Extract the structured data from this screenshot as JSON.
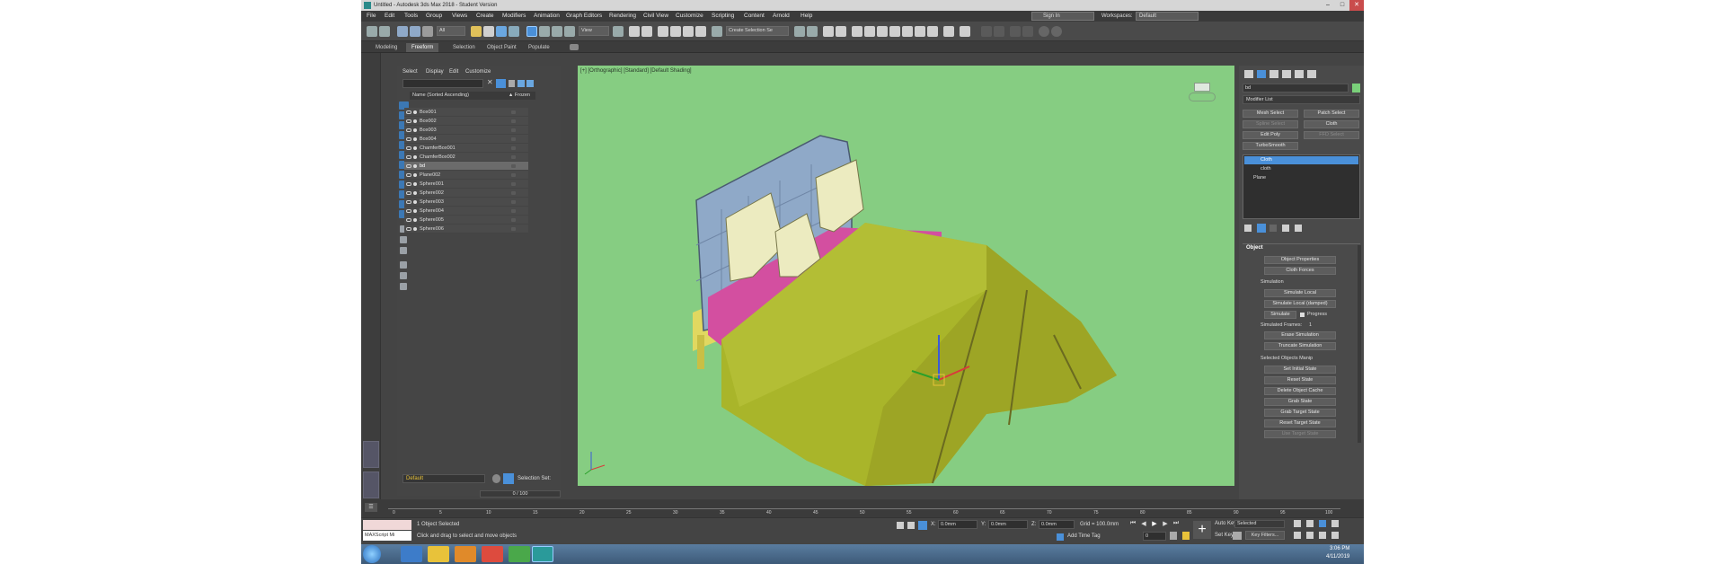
{
  "title_bar": {
    "title": "Untitled - Autodesk 3ds Max 2018 - Student Version"
  },
  "menu": [
    "File",
    "Edit",
    "Tools",
    "Group",
    "Views",
    "Create",
    "Modifiers",
    "Animation",
    "Graph Editors",
    "Rendering",
    "Civil View",
    "Customize",
    "Scripting",
    "Content",
    "Arnold",
    "Help"
  ],
  "user": {
    "sign_in": "Sign In",
    "workspaces_label": "Workspaces:",
    "workspace_value": "Default"
  },
  "toolbar": {
    "filter_value": "All",
    "view_value": "View",
    "selection_set_placeholder": "Create Selection Se"
  },
  "ribbon_tabs": [
    "Modeling",
    "Freeform",
    "Selection",
    "Object Paint",
    "Populate"
  ],
  "scene_explorer": {
    "menu": [
      "Select",
      "Display",
      "Edit",
      "Customize"
    ],
    "header_name": "Name (Sorted Ascending)",
    "header_frozen": "▲ Frozen",
    "rows": [
      "Box001",
      "Box002",
      "Box003",
      "Box004",
      "ChamferBox001",
      "ChamferBox002",
      "bd",
      "Plane002",
      "Sphere001",
      "Sphere002",
      "Sphere003",
      "Sphere004",
      "Sphere005",
      "Sphere006"
    ],
    "layer_value": "Default",
    "selection_set_label": "Selection Set:"
  },
  "viewport": {
    "label": "[+] [Orthographic] [Standard] [Default Shading]"
  },
  "command_panel": {
    "name_value": "bd",
    "modifier_list": "Modifier List",
    "buttons": [
      "Mesh Select",
      "Patch Select",
      "Spline Select",
      "Cloth",
      "Edit Poly",
      "FFD Select",
      "TurboSmooth"
    ],
    "stack": [
      "Cloth",
      "cloth",
      "Plane"
    ],
    "rollout_title": "Object",
    "object_buttons": [
      "Object Properties",
      "Cloth Forces"
    ],
    "simulation_label": "Simulation",
    "sim_buttons": [
      "Simulate Local",
      "Simulate Local (damped)",
      "Simulate"
    ],
    "progress_label": "Progress",
    "simulated_frames_label": "Simulated Frames:",
    "simulated_frames_value": "1",
    "sim_buttons2": [
      "Erase Simulation",
      "Truncate Simulation"
    ],
    "selected_manip_label": "Selected Objects Manip",
    "manip_buttons": [
      "Set Initial State",
      "Reset State",
      "Delete Object Cache",
      "Grab State",
      "Grab Target State",
      "Reset Target State",
      "Use Target State"
    ]
  },
  "timeline": {
    "frame_readout": "0 / 100",
    "ticks": [
      "0",
      "5",
      "10",
      "15",
      "20",
      "25",
      "30",
      "35",
      "40",
      "45",
      "50",
      "55",
      "60",
      "65",
      "70",
      "75",
      "80",
      "85",
      "90",
      "95",
      "100"
    ]
  },
  "status": {
    "maxscript_line": "MAXScript Mi",
    "selected": "1 Object Selected",
    "prompt": "Click and drag to select and move objects",
    "x_value": "0.0mm",
    "y_value": "0.0mm",
    "z_value": "0.0mm",
    "grid": "Grid = 100.0mm",
    "add_time_tag": "Add Time Tag",
    "auto_key": "Auto Key",
    "set_key": "Set Key",
    "key_mode": "Selected",
    "key_filters": "Key Filters...",
    "frame": "0"
  },
  "taskbar": {
    "time": "3:06 PM",
    "date": "4/11/2019"
  },
  "colors": {
    "viewport_bg": "#86cd82",
    "accent": "#4a90d9",
    "bed_sheet": "#a9b52a",
    "bed_mattress": "#d34fa0",
    "headboard": "#8fa9c8"
  }
}
